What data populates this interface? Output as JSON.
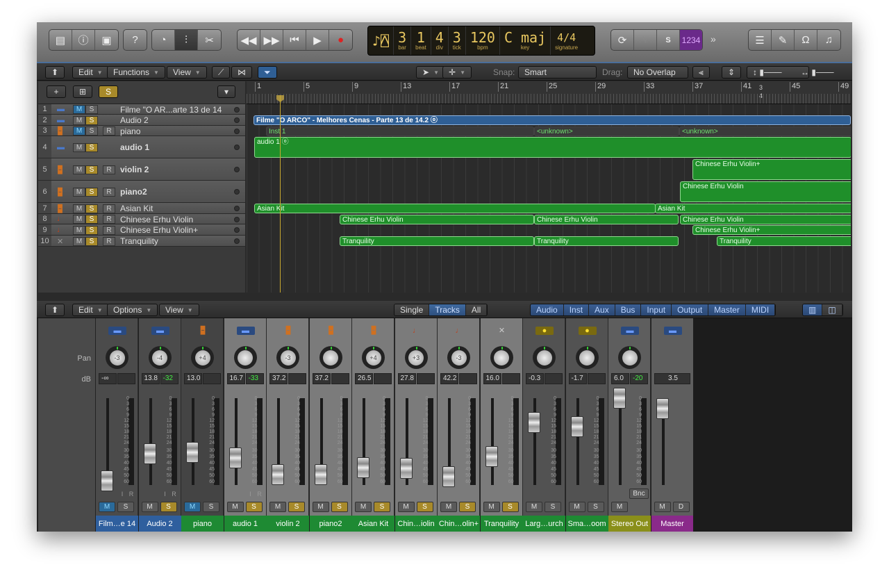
{
  "toolbar": {
    "left_icons": [
      "library-icon",
      "info-icon",
      "editor-toggle-icon"
    ],
    "help_icon": "help-icon",
    "mode_icons": [
      "smart-controls-icon",
      "mixer-icon",
      "editors-icon"
    ],
    "transport_icons": [
      "rewind-icon",
      "fast-forward-icon",
      "go-to-start-icon",
      "play-icon",
      "record-icon"
    ],
    "lcd": {
      "bar": "3",
      "beat": "1",
      "div": "4",
      "tick": "3",
      "bpm": "120",
      "key": "C maj",
      "signature": "4/4",
      "labels": {
        "bar": "bar",
        "beat": "beat",
        "div": "div",
        "tick": "tick",
        "bpm": "bpm",
        "key": "key",
        "signature": "signature"
      }
    },
    "mode_buttons": {
      "cycle": "⟳",
      "tuner": "⑂",
      "solo": "S",
      "count_in": "1234",
      "more": "»"
    },
    "right_icons": [
      "list-editors-icon",
      "note-pad-icon",
      "loop-browser-icon",
      "media-browser-icon"
    ]
  },
  "tracks_area": {
    "menus": {
      "edit": "Edit",
      "functions": "Functions",
      "view": "View"
    },
    "snap_label": "Snap:",
    "snap_value": "Smart",
    "drag_label": "Drag:",
    "drag_value": "No Overlap",
    "header_buttons": {
      "add": "+",
      "solo": "S"
    },
    "ruler": [
      "1",
      "5",
      "9",
      "13",
      "17",
      "21",
      "25",
      "29",
      "33",
      "37",
      "41",
      "45",
      "49"
    ],
    "ruler_extra": [
      "3",
      "4"
    ],
    "tracks": [
      {
        "num": "1",
        "name": "Filme \"O AR...arte 13 de 14",
        "icon": "audio-icon",
        "mute": true,
        "solo": false,
        "rec": false
      },
      {
        "num": "2",
        "name": "Audio 2",
        "icon": "audio-icon",
        "mute": false,
        "solo": true,
        "rec": false
      },
      {
        "num": "3",
        "name": "piano",
        "icon": "congas-icon",
        "mute": true,
        "solo": false,
        "rec": true
      },
      {
        "num": "4",
        "name": "audio 1",
        "icon": "audio-icon",
        "mute": false,
        "solo": true,
        "rec": false
      },
      {
        "num": "5",
        "name": "violin 2",
        "icon": "congas-icon",
        "mute": false,
        "solo": true,
        "rec": true
      },
      {
        "num": "6",
        "name": "piano2",
        "icon": "congas-icon",
        "mute": false,
        "solo": true,
        "rec": true
      },
      {
        "num": "7",
        "name": "Asian Kit",
        "icon": "congas-icon",
        "mute": false,
        "solo": true,
        "rec": true
      },
      {
        "num": "8",
        "name": "Chinese Erhu Violin",
        "icon": "violin-icon",
        "mute": false,
        "solo": true,
        "rec": true
      },
      {
        "num": "9",
        "name": "Chinese Erhu Violin+",
        "icon": "violin-icon",
        "mute": false,
        "solo": true,
        "rec": true
      },
      {
        "num": "10",
        "name": "Tranquility",
        "icon": "keyboard-stand-icon",
        "mute": false,
        "solo": true,
        "rec": true
      }
    ],
    "regions": [
      {
        "track": 2,
        "label": "Filme \"O ARCO\" - Melhores Cenas - Parte 13 de 14.2 ⓞ",
        "style": "blue"
      },
      {
        "track": 3,
        "label": "Inst 1",
        "style": "dk"
      },
      {
        "track": 3,
        "label": "<unknown>",
        "style": "dk"
      },
      {
        "track": 3,
        "label": "<unknown>",
        "style": "dk"
      },
      {
        "track": 4,
        "label": "audio 1 ⓞ",
        "style": "green"
      },
      {
        "track": 5,
        "label": "Chinese Erhu Violin+",
        "style": "green"
      },
      {
        "track": 6,
        "label": "Chinese Erhu Violin",
        "style": "green"
      },
      {
        "track": 7,
        "label": "Asian Kit",
        "style": "green"
      },
      {
        "track": 7,
        "label": "Asian Kit",
        "style": "green"
      },
      {
        "track": 8,
        "label": "Chinese Erhu Violin",
        "style": "green"
      },
      {
        "track": 8,
        "label": "Chinese Erhu Violin",
        "style": "green"
      },
      {
        "track": 8,
        "label": "Chinese Erhu Violin",
        "style": "green"
      },
      {
        "track": 9,
        "label": "Chinese Erhu Violin+",
        "style": "green"
      },
      {
        "track": 10,
        "label": "Tranquility",
        "style": "green"
      },
      {
        "track": 10,
        "label": "Tranquility",
        "style": "green"
      },
      {
        "track": 10,
        "label": "Tranquility",
        "style": "green"
      }
    ]
  },
  "mixer": {
    "menus": {
      "edit": "Edit",
      "options": "Options",
      "view": "View"
    },
    "scope": [
      "Single",
      "Tracks",
      "All"
    ],
    "scope_selected": "Tracks",
    "filters": [
      "Audio",
      "Inst",
      "Aux",
      "Bus",
      "Input",
      "Output",
      "Master",
      "MIDI"
    ],
    "row_labels": {
      "pan": "Pan",
      "db": "dB"
    },
    "scale": [
      "0",
      "3",
      "6",
      "9",
      "12",
      "15",
      "18",
      "21",
      "24",
      "30",
      "35",
      "40",
      "45",
      "50",
      "60"
    ],
    "strips": [
      {
        "name": "Film…e 14",
        "icon": "audio",
        "pan": "-3",
        "db": "-∞",
        "peak": "",
        "m": "blue",
        "s": false,
        "ir": true,
        "color": "#2f5f9e",
        "bg": "#4b4b4b",
        "fader": 0.05
      },
      {
        "name": "Audio 2",
        "icon": "audio",
        "pan": "-4",
        "db": "13.8",
        "peak": "-32",
        "m": "off",
        "s": true,
        "ir": true,
        "color": "#2f5f9e",
        "bg": "#4b4b4b",
        "fader": 0.36
      },
      {
        "name": "piano",
        "icon": "congas",
        "pan": "+4",
        "db": "13.0",
        "peak": "",
        "m": "blue",
        "s": false,
        "ir": false,
        "color": "#1e8a33",
        "bg": "#444",
        "fader": 0.38
      },
      {
        "name": "audio 1",
        "icon": "audio",
        "pan": "",
        "db": "16.7",
        "peak": "-33",
        "m": "off",
        "s": true,
        "ir": true,
        "color": "#1e8a33",
        "bg": "#7b7b7b",
        "fader": 0.31
      },
      {
        "name": "violin 2",
        "icon": "congas",
        "pan": "-3",
        "db": "37.2",
        "peak": "",
        "m": "off",
        "s": true,
        "ir": false,
        "color": "#1e8a33",
        "bg": "#7b7b7b",
        "fader": 0.12
      },
      {
        "name": "piano2",
        "icon": "congas",
        "pan": "",
        "db": "37.2",
        "peak": "",
        "m": "off",
        "s": true,
        "ir": false,
        "color": "#1e8a33",
        "bg": "#7b7b7b",
        "fader": 0.12
      },
      {
        "name": "Asian Kit",
        "icon": "congas",
        "pan": "+4",
        "db": "26.5",
        "peak": "",
        "m": "off",
        "s": true,
        "ir": false,
        "color": "#1e8a33",
        "bg": "#7b7b7b",
        "fader": 0.2
      },
      {
        "name": "Chin…iolin",
        "icon": "violin",
        "pan": "+3",
        "db": "27.8",
        "peak": "",
        "m": "off",
        "s": true,
        "ir": false,
        "color": "#1e8a33",
        "bg": "#7b7b7b",
        "fader": 0.19
      },
      {
        "name": "Chin…olin+",
        "icon": "violin",
        "pan": "-3",
        "db": "42.2",
        "peak": "",
        "m": "off",
        "s": true,
        "ir": false,
        "color": "#1e8a33",
        "bg": "#7b7b7b",
        "fader": 0.1
      },
      {
        "name": "Tranquility",
        "icon": "keyboard",
        "pan": "",
        "db": "16.0",
        "peak": "",
        "m": "off",
        "s": true,
        "ir": false,
        "color": "#1e8a33",
        "bg": "#7b7b7b",
        "fader": 0.33
      },
      {
        "name": "Larg…urch",
        "icon": "aux",
        "pan": "",
        "db": "-0.3",
        "peak": "",
        "m": "off",
        "s": false,
        "ir": false,
        "color": "#1e8a33",
        "bg": "#525252",
        "fader": 0.72
      },
      {
        "name": "Sma…oom",
        "icon": "aux",
        "pan": "",
        "db": "-1.7",
        "peak": "",
        "m": "off",
        "s": false,
        "ir": false,
        "color": "#1e8a33",
        "bg": "#525252",
        "fader": 0.67
      },
      {
        "name": "Stereo Out",
        "icon": "audio",
        "pan": "",
        "db": "6.0",
        "peak": "-20",
        "m": "off",
        "s": null,
        "ir": false,
        "bnc": "Bnc",
        "color": "#8a8f1a",
        "bg": "#5e5e5e",
        "fader": 1.0
      },
      {
        "name": "Master",
        "icon": "audio",
        "pan": null,
        "db": "3.5",
        "peak": null,
        "m": "off",
        "s": null,
        "d": "D",
        "ir": false,
        "color": "#8a2a8a",
        "bg": "#5e5e5e",
        "fader": 0.88
      }
    ],
    "m_label": "M",
    "s_label": "S",
    "i_label": "I",
    "r_label": "R"
  }
}
